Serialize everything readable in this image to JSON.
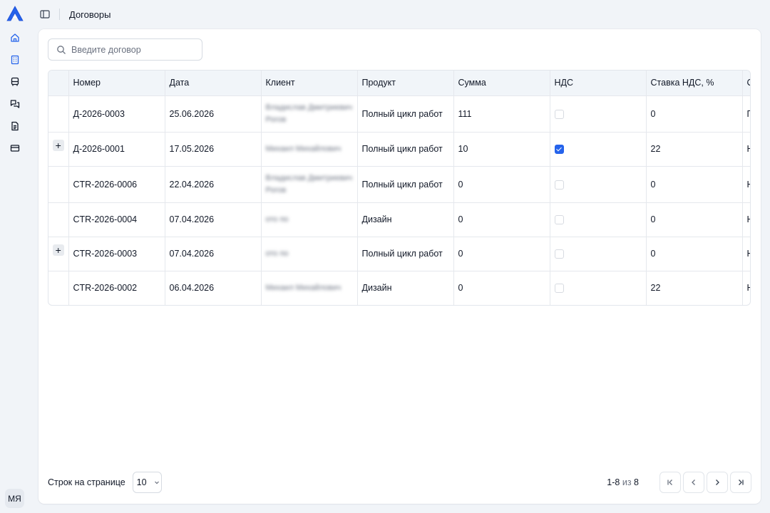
{
  "app": {
    "logo": "a-logo-icon"
  },
  "sidebar": {
    "items": [
      {
        "icon": "home-icon"
      },
      {
        "icon": "building-icon",
        "active": true
      },
      {
        "icon": "bus-icon"
      },
      {
        "icon": "chat-icon"
      },
      {
        "icon": "document-icon"
      },
      {
        "icon": "card-icon"
      }
    ],
    "avatar": "МЯ"
  },
  "header": {
    "title": "Договоры"
  },
  "search": {
    "placeholder": "Введите договор",
    "value": ""
  },
  "table": {
    "columns": [
      "Номер",
      "Дата",
      "Клиент",
      "Продукт",
      "Сумма",
      "НДС",
      "Ставка НДС, %",
      "С"
    ],
    "rows": [
      {
        "expandable": false,
        "number": "Д-2026-0003",
        "date": "25.06.2026",
        "client": "Владислав Дмитриевич Рогов",
        "product": "Полный цикл работ",
        "sum": "111",
        "vat": false,
        "vat_rate": "0",
        "extra": "П"
      },
      {
        "expandable": true,
        "number": "Д-2026-0001",
        "date": "17.05.2026",
        "client": "Михаил Михайлович",
        "product": "Полный цикл работ",
        "sum": "10",
        "vat": true,
        "vat_rate": "22",
        "extra": "Н"
      },
      {
        "expandable": false,
        "number": "CTR-2026-0006",
        "date": "22.04.2026",
        "client": "Владислав Дмитриевич Рогов",
        "product": "Полный цикл работ",
        "sum": "0",
        "vat": false,
        "vat_rate": "0",
        "extra": "Н"
      },
      {
        "expandable": false,
        "number": "CTR-2026-0004",
        "date": "07.04.2026",
        "client": "ото по",
        "product": "Дизайн",
        "sum": "0",
        "vat": false,
        "vat_rate": "0",
        "extra": "Н"
      },
      {
        "expandable": true,
        "number": "CTR-2026-0003",
        "date": "07.04.2026",
        "client": "ото по",
        "product": "Полный цикл работ",
        "sum": "0",
        "vat": false,
        "vat_rate": "0",
        "extra": "Н"
      },
      {
        "expandable": false,
        "number": "CTR-2026-0002",
        "date": "06.04.2026",
        "client": "Михаил Михайлович",
        "product": "Дизайн",
        "sum": "0",
        "vat": false,
        "vat_rate": "22",
        "extra": "Н"
      }
    ]
  },
  "pagination": {
    "rows_label": "Строк на странице",
    "rows_value": "10",
    "range": "1-8",
    "of": "из",
    "total": "8"
  },
  "colors": {
    "accent": "#2563eb",
    "background": "#f1f4f8",
    "header_bg": "#f1f5f9"
  }
}
